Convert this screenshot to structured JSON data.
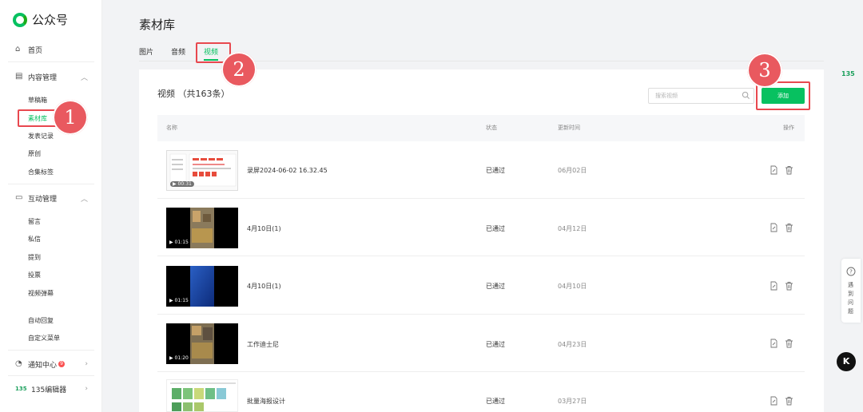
{
  "app": {
    "title": "公众号"
  },
  "sidebar": {
    "home": "首页",
    "content": {
      "label": "内容管理",
      "items": [
        "草稿箱",
        "素材库",
        "发表记录",
        "原创",
        "合集标签"
      ]
    },
    "interact": {
      "label": "互动管理",
      "items": [
        "留言",
        "私信",
        "提到",
        "投票",
        "视频弹幕"
      ]
    },
    "auto": [
      "自动回复",
      "自定义菜单"
    ],
    "notify": {
      "label": "通知中心",
      "badge": "9"
    },
    "editor": {
      "label": "135编辑器",
      "logo": "135"
    }
  },
  "page": {
    "title": "素材库",
    "tabs": [
      "图片",
      "音频",
      "视频"
    ]
  },
  "panel": {
    "title": "视频 （共163条）",
    "search_placeholder": "搜索视频",
    "add_label": "添加",
    "columns": [
      "名称",
      "状态",
      "更新时间",
      "操作"
    ]
  },
  "rows": [
    {
      "name": "录屏2024-06-02 16.32.45",
      "status": "已通过",
      "date": "06月02日",
      "duration": "00:31"
    },
    {
      "name": "4月10日(1)",
      "status": "已通过",
      "date": "04月12日",
      "duration": "01:15"
    },
    {
      "name": "4月10日(1)",
      "status": "已通过",
      "date": "04月10日",
      "duration": "01:15"
    },
    {
      "name": "工作迪士尼",
      "status": "已通过",
      "date": "04月23日",
      "duration": "01:20"
    },
    {
      "name": "批量海报设计",
      "status": "已通过",
      "date": "03月27日",
      "duration": ""
    }
  ],
  "rail": {
    "logo": "135",
    "help": "遇到问题",
    "k": "K"
  },
  "annotations": [
    "1",
    "2",
    "3"
  ],
  "colors": {
    "accent": "#07c160",
    "highlight": "#e8484f",
    "marker": "#e9595f"
  }
}
